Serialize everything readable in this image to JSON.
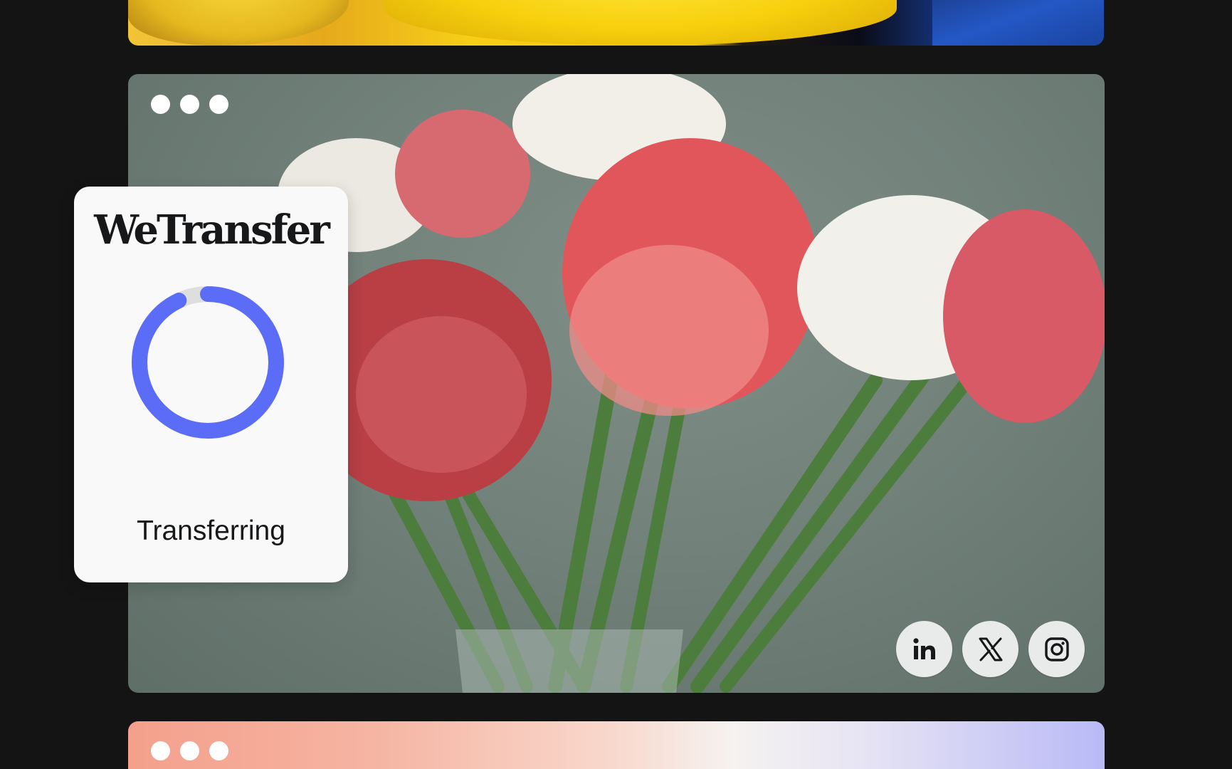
{
  "brand": {
    "logo_text": "WeTransfer"
  },
  "transfer_panel": {
    "status_label": "Transferring",
    "progress_fraction": 0.93,
    "ring_color": "#5b6cf6",
    "track_color": "#dedede"
  },
  "socials": [
    {
      "name": "linkedin-icon",
      "label": "in"
    },
    {
      "name": "x-icon",
      "label": "X"
    },
    {
      "name": "instagram-icon",
      "label": "Instagram"
    }
  ],
  "colors": {
    "page_background": "#141414",
    "panel_background": "#f9f9f9",
    "accent": "#5b6cf6"
  }
}
